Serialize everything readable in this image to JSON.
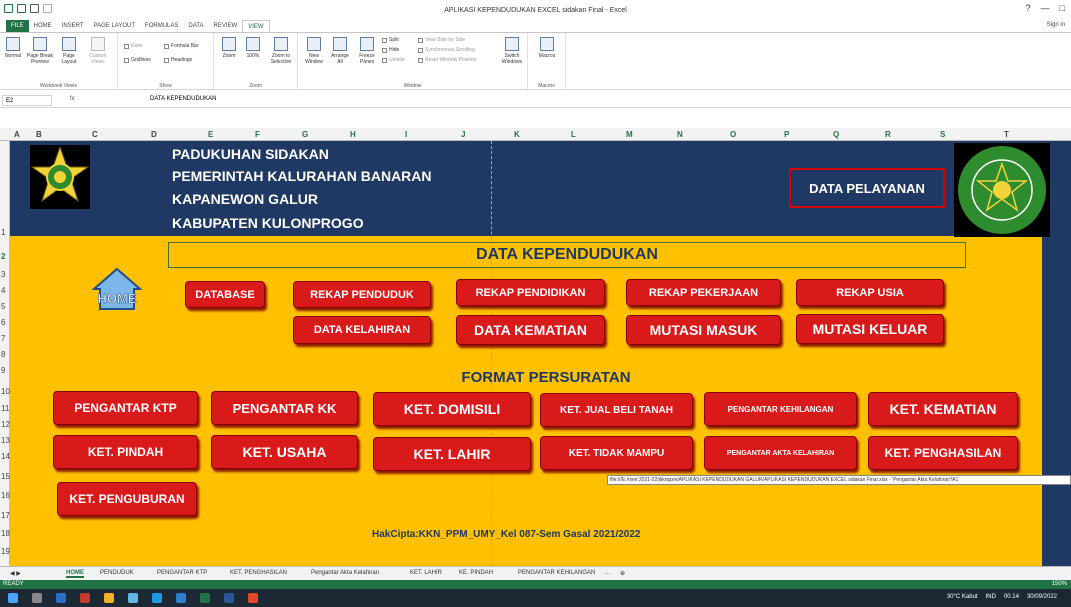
{
  "window": {
    "title": "APLIKASI KEPENDUDUKAN EXCEL sidakan Final - Excel",
    "controls": [
      "?",
      "—",
      "□"
    ],
    "sign_in": "Sign in"
  },
  "ribbon_tabs": [
    "FILE",
    "HOME",
    "INSERT",
    "PAGE LAYOUT",
    "FORMULAS",
    "DATA",
    "REVIEW",
    "VIEW"
  ],
  "ribbon": {
    "workbook_views": {
      "name": "Workbook Views",
      "buttons": [
        "Normal",
        "Page Break Preview",
        "Page Layout",
        "Custom Views"
      ]
    },
    "show": {
      "name": "Show",
      "items": [
        "Ruler",
        "Formula Bar",
        "Gridlines",
        "Headings"
      ]
    },
    "zoom": {
      "name": "Zoom",
      "buttons": [
        "Zoom",
        "100%",
        "Zoom to Selection"
      ]
    },
    "window": {
      "name": "Window",
      "buttons": [
        "New Window",
        "Arrange All",
        "Freeze Panes",
        "Split",
        "Hide",
        "Unhide",
        "View Side by Side",
        "Synchronous Scrolling",
        "Reset Window Position",
        "Switch Windows"
      ]
    },
    "macros": {
      "name": "Macros",
      "buttons": [
        "Macros"
      ]
    }
  },
  "formula_bar": {
    "name_box": "E2",
    "fx": "fx",
    "value": "DATA KEPENDUDUKAN"
  },
  "columns": [
    "A",
    "B",
    "C",
    "D",
    "E",
    "F",
    "G",
    "H",
    "I",
    "J",
    "K",
    "L",
    "M",
    "N",
    "O",
    "P",
    "Q",
    "R",
    "S",
    "T"
  ],
  "rows": [
    "1",
    "2",
    "3",
    "4",
    "5",
    "6",
    "7",
    "8",
    "9",
    "10",
    "11",
    "12",
    "13",
    "14",
    "15",
    "16",
    "17",
    "18",
    "19"
  ],
  "header": {
    "line1": "PADUKUHAN SIDAKAN",
    "line2": "PEMERINTAH KALURAHAN BANARAN",
    "line3": "KAPANEWON GALUR",
    "line4": "KABUPATEN KULONPROGO",
    "service_button": "DATA PELAYANAN",
    "right_logo_text": "UNIVERSITAS MUHAMMADIYAH YOGYAKARTA"
  },
  "section_title": "DATA KEPENDUDUKAN",
  "home_icon_label": "HOME",
  "menu_row1": [
    "DATABASE",
    "REKAP PENDUDUK",
    "REKAP PENDIDIKAN",
    "REKAP PEKERJAAN",
    "REKAP USIA"
  ],
  "menu_row2": [
    "DATA KELAHIRAN",
    "DATA KEMATIAN",
    "MUTASI MASUK",
    "MUTASI KELUAR"
  ],
  "format_title": "FORMAT PERSURATAN",
  "letter_row1": [
    "PENGANTAR KTP",
    "PENGANTAR KK",
    "KET. DOMISILI",
    "KET. JUAL BELI TANAH",
    "PENGANTAR KEHILANGAN",
    "KET. KEMATIAN"
  ],
  "letter_row2": [
    "KET. PINDAH",
    "KET. USAHA",
    "KET. LAHIR",
    "KET. TIDAK MAMPU",
    "PENGANTAR AKTA KELAHIRAN",
    "KET. PENGHASILAN"
  ],
  "letter_row3": [
    "KET. PENGUBURAN"
  ],
  "copyright": "HakCipta:KKN_PPM_UMY_Kel 087-Sem Gasal 2021/2022",
  "hyperlink_tooltip": "file:///E:/riset 2021-22/jkknppm/APLIKASI KEPENDUDUKAN GALUR/APLIKASI KEPENDUDUKAN EXCEL sidakan Final.xlsx - 'Pengantar Akta Kelahiran'!A1",
  "sheet_tabs": [
    "HOME",
    "PENDUDUK",
    "PENGANTAR KTP",
    "KET. PENGHASILAN",
    "Pengantar Akta Kelahiran",
    "KET. LAHIR",
    "KE. PINDAH",
    "PENGANTAR KEHILANGAN",
    "..."
  ],
  "status": {
    "mode": "READY",
    "zoom": "150%"
  },
  "taskbar": {
    "weather": "30°C Kabut",
    "lang": "IND",
    "time": "00.14",
    "date": "30/09/2022"
  },
  "colors": {
    "navy": "#1f3864",
    "orange": "#ffc000",
    "button_red": "#d91a1a",
    "excel_green": "#217346"
  }
}
